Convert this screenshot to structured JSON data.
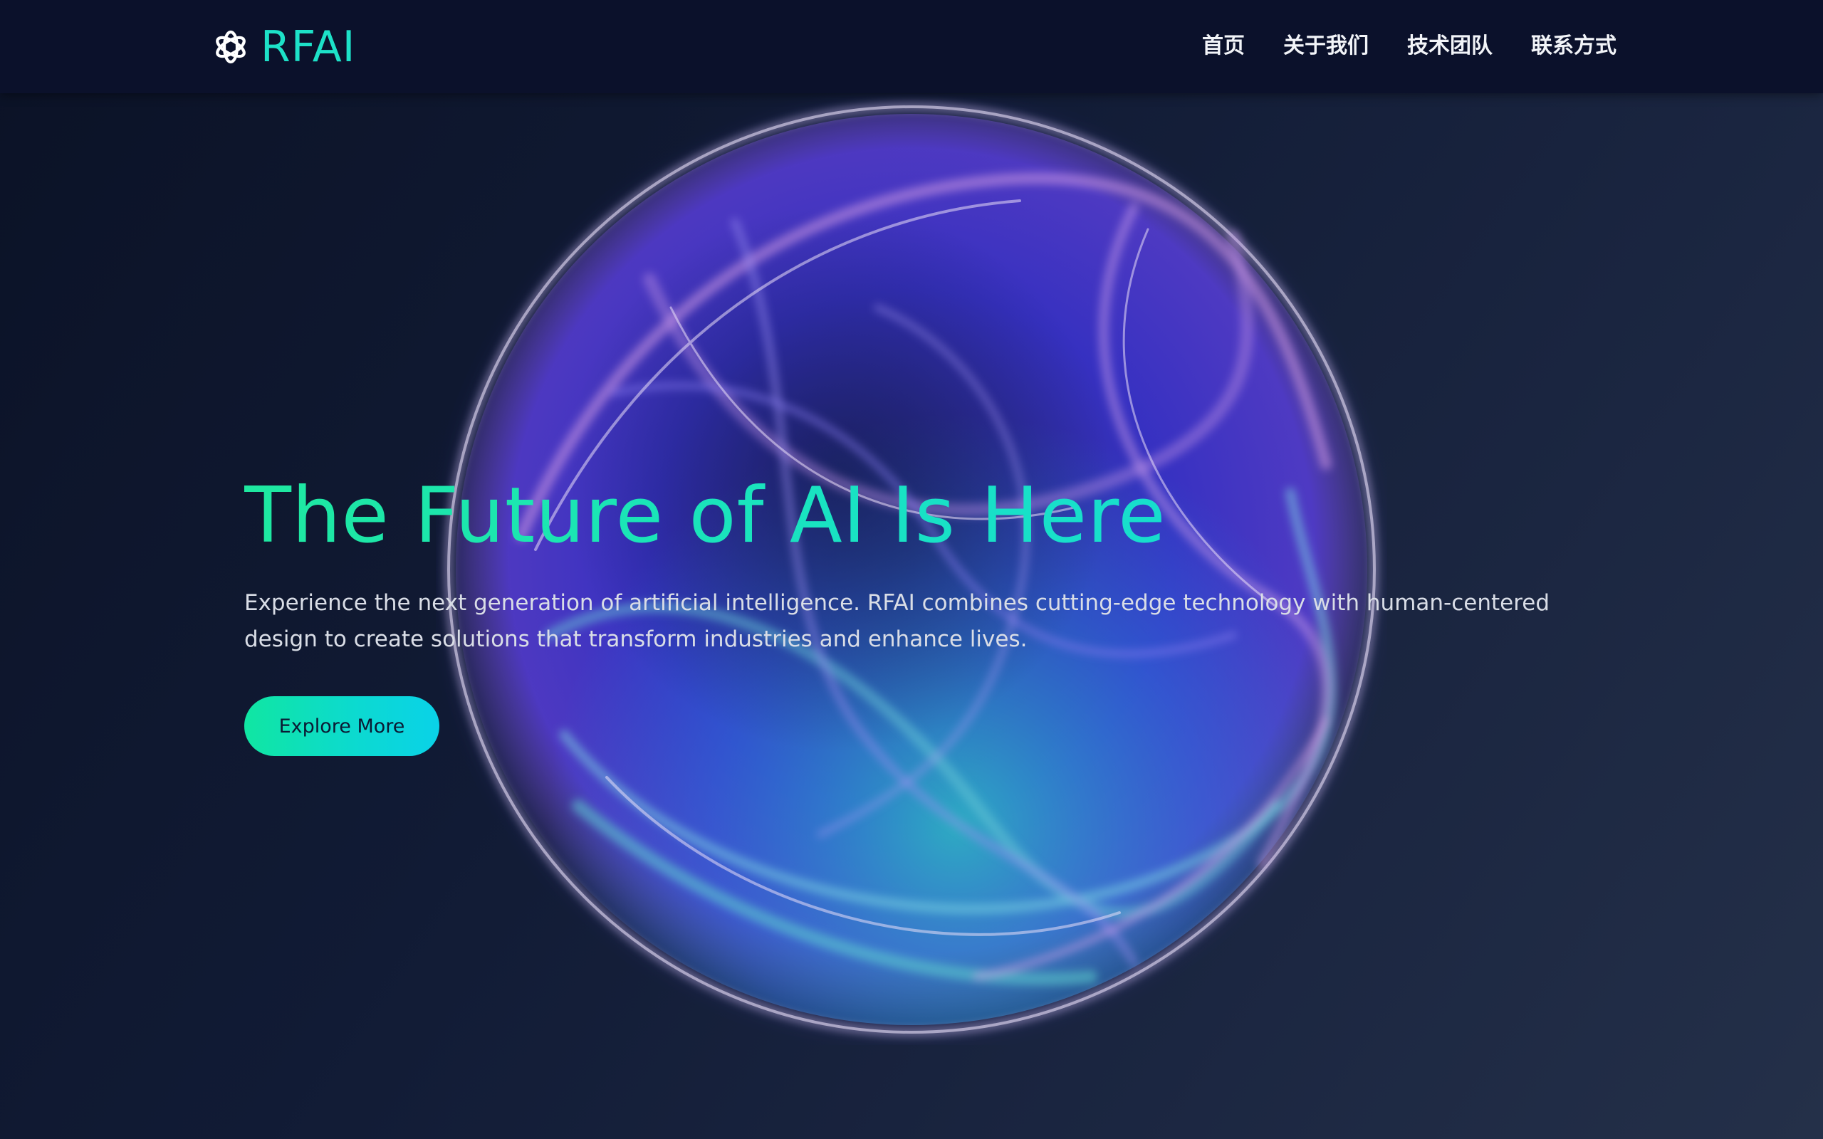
{
  "brand": {
    "name": "RFAI",
    "icon": "knot-logo-icon",
    "accent_color": "#1de1c8"
  },
  "nav": {
    "items": [
      {
        "label": "首页"
      },
      {
        "label": "关于我们"
      },
      {
        "label": "技术团队"
      },
      {
        "label": "联系方式"
      }
    ]
  },
  "hero": {
    "title": "The Future of AI Is Here",
    "subtitle": "Experience the next generation of artificial intelligence. RFAI combines cutting-edge technology with human-centered design to create solutions that transform industries and enhance lives.",
    "cta_label": "Explore More",
    "title_gradient": [
      "#1ee8a0",
      "#15d8da"
    ],
    "cta_gradient": [
      "#10e6a2",
      "#0ad2e8"
    ]
  },
  "background": {
    "colors": [
      "#0b1226",
      "#243049"
    ],
    "orb_colors": [
      "#3a2fd8",
      "#b36ad9",
      "#2fd0c5",
      "#2a6fe0"
    ]
  }
}
